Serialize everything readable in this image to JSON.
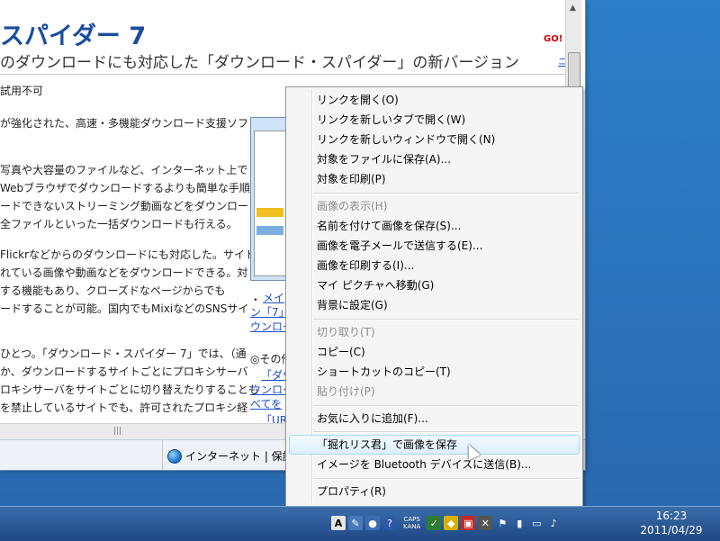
{
  "page": {
    "title": "スパイダー 7",
    "subtitle": "のダウンロードにも対応した「ダウンロード・スパイダー」の新バージョン",
    "go_text": "GO!",
    "go_link": "ニ",
    "lines": [
      "試用不可",
      "が強化された、高速・多機能ダウンロード支援ソフ",
      "写真や大容量のファイルなど、インターネット上で",
      "Webブラウザでダウンロードするよりも簡単な手順",
      "ードできないストリーミング動画などをダウンロード",
      "全ファイルといった一括ダウンロードも行える。",
      "Flickrなどからのダウンロードにも対応した。サイト",
      "れている画像や動画などをダウンロードできる。対",
      "する機能もあり、クローズドなページからでも",
      "ードすることが可能。国内でもMixiなどのSNSサイ",
      "ひとつ。「ダウンロード・スパイダー 7」では、（通",
      "か、ダウンロードするサイトごとにプロキシサーバ",
      "ロキシサーバをサイトごとに切り替えたりすることも",
      "を禁止しているサイトでも、許可されたプロキシ経"
    ],
    "right_links": [
      "メイ",
      "ン「7」で",
      "ウンロー",
      "◎その他",
      "「ダウ",
      "ウンロー",
      "べてを",
      "「URL"
    ],
    "bullet": "・"
  },
  "status": {
    "zone": "インターネット | 保護"
  },
  "context_menu": {
    "items": [
      {
        "label": "リンクを開く(O)",
        "disabled": false
      },
      {
        "label": "リンクを新しいタブで開く(W)",
        "disabled": false
      },
      {
        "label": "リンクを新しいウィンドウで開く(N)",
        "disabled": false
      },
      {
        "label": "対象をファイルに保存(A)...",
        "disabled": false
      },
      {
        "label": "対象を印刷(P)",
        "disabled": false
      },
      {
        "label": "画像の表示(H)",
        "disabled": true
      },
      {
        "label": "名前を付けて画像を保存(S)...",
        "disabled": false
      },
      {
        "label": "画像を電子メールで送信する(E)...",
        "disabled": false
      },
      {
        "label": "画像を印刷する(I)...",
        "disabled": false
      },
      {
        "label": "マイ ピクチャへ移動(G)",
        "disabled": false
      },
      {
        "label": "背景に設定(G)",
        "disabled": false
      },
      {
        "label": "切り取り(T)",
        "disabled": true
      },
      {
        "label": "コピー(C)",
        "disabled": false
      },
      {
        "label": "ショートカットのコピー(T)",
        "disabled": false
      },
      {
        "label": "貼り付け(P)",
        "disabled": true
      },
      {
        "label": "お気に入りに追加(F)...",
        "disabled": false
      },
      {
        "label": "「掘れリス君」で画像を保存",
        "disabled": false
      },
      {
        "label": "イメージを Bluetooth デバイスに送信(B)...",
        "disabled": false
      },
      {
        "label": "プロパティ(R)",
        "disabled": false
      }
    ]
  },
  "taskbar": {
    "ime_a": "A",
    "caps": "CAPS",
    "kana": "KANA",
    "time": "16:23",
    "date": "2011/04/29"
  },
  "colors": {
    "desktop": "#2b73bc",
    "title": "#1a4e9c",
    "link": "#1a4ed0",
    "menu_bg": "#f5f5f5",
    "highlight": "#dcefff"
  }
}
